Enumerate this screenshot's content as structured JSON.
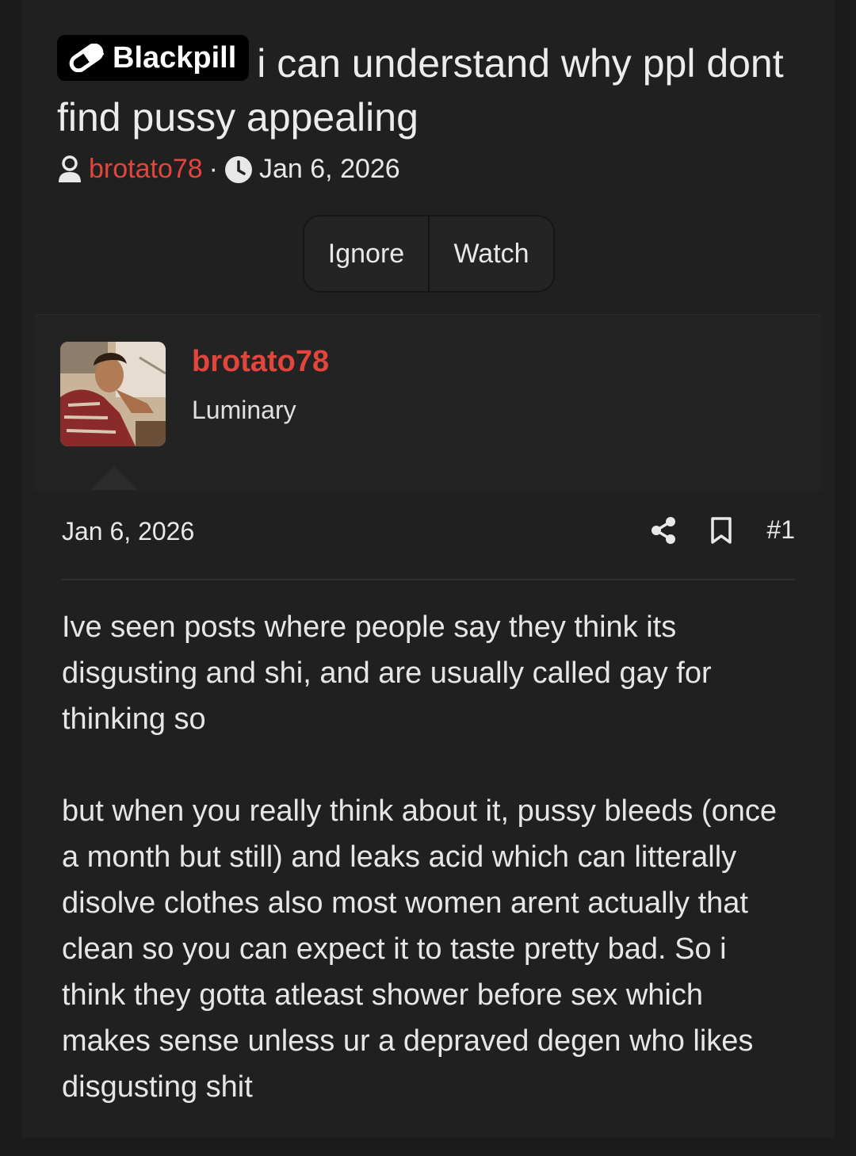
{
  "thread": {
    "prefix_label": "Blackpill",
    "prefix_icon": "pill-icon",
    "title": "i can understand why ppl dont find pussy appealing",
    "author": "brotato78",
    "separator": "·",
    "date": "Jan 6, 2026"
  },
  "actions": {
    "ignore_label": "Ignore",
    "watch_label": "Watch"
  },
  "post": {
    "author_name": "brotato78",
    "author_title": "Luminary",
    "date": "Jan 6, 2026",
    "number": "#1",
    "paragraphs": [
      "Ive seen posts where people say they think its disgusting and shi, and are usually called gay for thinking so",
      "but when you really think about it, pussy bleeds (once a month but still) and leaks acid which can litterally disolve clothes also most women arent actually that clean so you can expect it to taste pretty bad. So i think they gotta atleast shower before sex which makes sense unless ur a depraved degen who likes disgusting shit"
    ]
  },
  "colors": {
    "accent": "#e2453c",
    "background": "#202020",
    "card": "#232323"
  }
}
